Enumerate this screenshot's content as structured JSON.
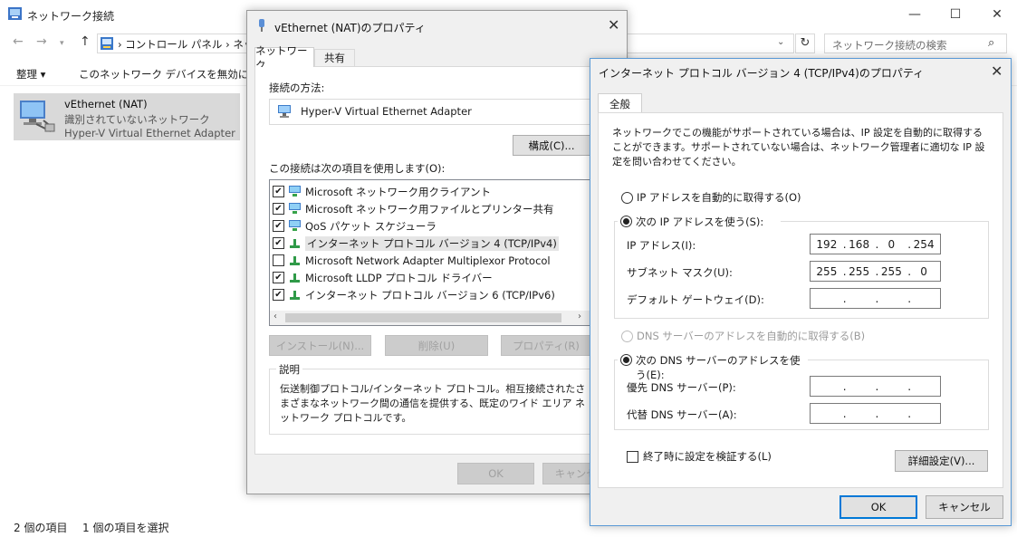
{
  "explorer": {
    "title": "ネットワーク接続",
    "address": "› コントロール パネル › ネット",
    "search_placeholder": "ネットワーク接続の検索",
    "cmd": {
      "organize": "整理 ▾",
      "disable": "このネットワーク デバイスを無効にする"
    },
    "item": {
      "name": "vEthernet (NAT)",
      "status": "識別されていないネットワーク",
      "adapter": "Hyper-V Virtual Ethernet Adapter"
    },
    "status_bar": {
      "count": "2 個の項目",
      "selected": "1 個の項目を選択"
    }
  },
  "prop": {
    "title": "vEthernet (NAT)のプロパティ",
    "tabs": [
      "ネットワーク",
      "共有"
    ],
    "connect_using_label": "接続の方法:",
    "adapter": "Hyper-V Virtual Ethernet Adapter",
    "configure": "構成(C)...",
    "items_label": "この接続は次の項目を使用します(O):",
    "items": [
      {
        "label": "Microsoft ネットワーク用クライアント",
        "checked": "✔"
      },
      {
        "label": "Microsoft ネットワーク用ファイルとプリンター共有",
        "checked": "✔"
      },
      {
        "label": "QoS パケット スケジューラ",
        "checked": "✔"
      },
      {
        "label": "インターネット プロトコル バージョン 4 (TCP/IPv4)",
        "checked": "✔"
      },
      {
        "label": "Microsoft Network Adapter Multiplexor Protocol",
        "checked": ""
      },
      {
        "label": "Microsoft LLDP プロトコル ドライバー",
        "checked": "✔"
      },
      {
        "label": "インターネット プロトコル バージョン 6 (TCP/IPv6)",
        "checked": "✔"
      }
    ],
    "install": "インストール(N)...",
    "uninstall": "削除(U)",
    "properties": "プロパティ(R)",
    "desc_label": "説明",
    "desc": "伝送制御プロトコル/インターネット プロトコル。相互接続されたさまざまなネットワーク間の通信を提供する、既定のワイド エリア ネットワーク プロトコルです。",
    "ok": "OK",
    "cancel": "キャンセル"
  },
  "ipv4": {
    "title": "インターネット プロトコル バージョン 4 (TCP/IPv4)のプロパティ",
    "tab": "全般",
    "intro": "ネットワークでこの機能がサポートされている場合は、IP 設定を自動的に取得することができます。サポートされていない場合は、ネットワーク管理者に適切な IP 設定を問い合わせてください。",
    "auto_ip": "IP アドレスを自動的に取得する(O)",
    "manual_ip": "次の IP アドレスを使う(S):",
    "ip_label": "IP アドレス(I):",
    "ip": [
      "192",
      "168",
      "0",
      "254"
    ],
    "mask_label": "サブネット マスク(U):",
    "mask": [
      "255",
      "255",
      "255",
      "0"
    ],
    "gw_label": "デフォルト ゲートウェイ(D):",
    "auto_dns": "DNS サーバーのアドレスを自動的に取得する(B)",
    "manual_dns": "次の DNS サーバーのアドレスを使う(E):",
    "dns1_label": "優先 DNS サーバー(P):",
    "dns2_label": "代替 DNS サーバー(A):",
    "validate": "終了時に設定を検証する(L)",
    "advanced": "詳細設定(V)...",
    "ok": "OK",
    "cancel": "キャンセル"
  },
  "colors": {
    "accent": "#0078d7",
    "dialog_bg": "#f0f0f0",
    "selected_item": "#d9d9d9"
  }
}
